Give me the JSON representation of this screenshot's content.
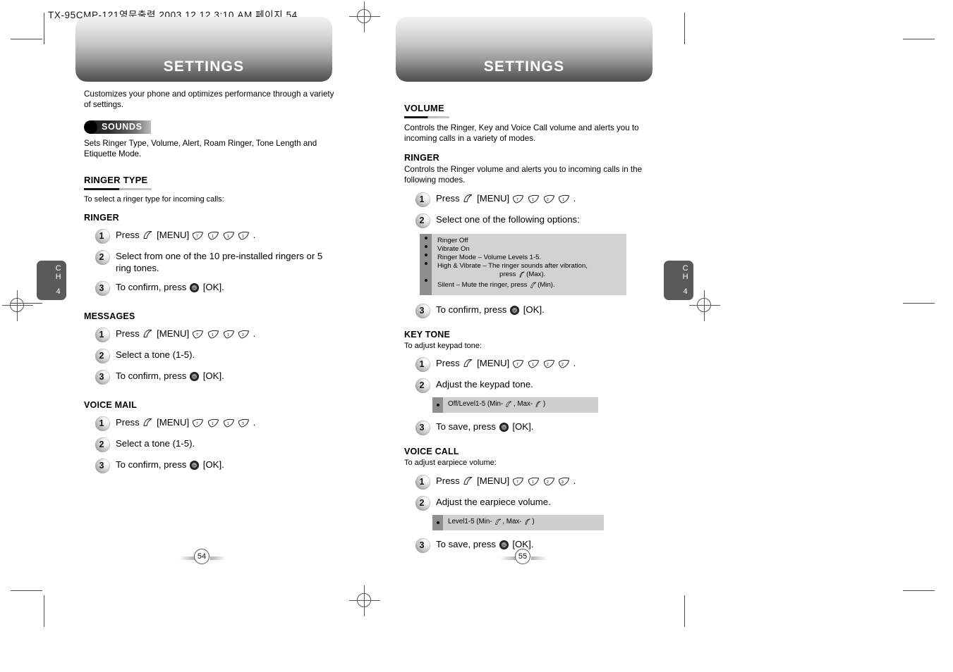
{
  "running_head": "TX-95CMP-121영문출력  2003.12.12 3:10 AM  페이지 54",
  "banner_title_left": "SETTINGS",
  "banner_title_right": "SETTINGS",
  "chapter_tab": {
    "label": "CH",
    "number": "4"
  },
  "folio": {
    "left": "54",
    "right": "55"
  },
  "left_page": {
    "intro": "Customizes your phone and optimizes performance through a variety of settings.",
    "badge": "SOUNDS",
    "badge_desc": "Sets Ringer Type, Volume, Alert, Roam Ringer, Tone Length and Etiquette Mode.",
    "section_title": "RINGER TYPE",
    "section_note": "To select a ringer type for incoming calls:",
    "groups": [
      {
        "heading": "RINGER",
        "steps": [
          {
            "num": "1",
            "text_before": "Press",
            "menu": "[MENU]",
            "keys": [
              "7",
              "1",
              "1",
              "1"
            ],
            "text_after": "."
          },
          {
            "num": "2",
            "text": "Select from one of the 10 pre-installed ringers or 5 ring tones."
          },
          {
            "num": "3",
            "text_before": "To confirm, press",
            "ok": "[OK]",
            "text_after": "."
          }
        ]
      },
      {
        "heading": "MESSAGES",
        "steps": [
          {
            "num": "1",
            "text_before": "Press",
            "menu": "[MENU]",
            "keys": [
              "7",
              "1",
              "1",
              "2"
            ],
            "text_after": "."
          },
          {
            "num": "2",
            "text": "Select a tone (1-5)."
          },
          {
            "num": "3",
            "text_before": "To confirm, press",
            "ok": "[OK]",
            "text_after": "."
          }
        ]
      },
      {
        "heading": "VOICE MAIL",
        "steps": [
          {
            "num": "1",
            "text_before": "Press",
            "menu": "[MENU]",
            "keys": [
              "7",
              "1",
              "1",
              "3"
            ],
            "text_after": "."
          },
          {
            "num": "2",
            "text": "Select a tone (1-5)."
          },
          {
            "num": "3",
            "text_before": "To confirm, press",
            "ok": "[OK]",
            "text_after": "."
          }
        ]
      }
    ]
  },
  "right_page": {
    "section_title": "VOLUME",
    "section_desc": "Controls the Ringer, Key and Voice Call volume and alerts you to incoming calls in a variety of modes.",
    "ringer": {
      "heading": "RINGER",
      "desc": "Controls the Ringer volume and alerts you to incoming calls in the following modes.",
      "steps": [
        {
          "num": "1",
          "text_before": "Press",
          "menu": "[MENU]",
          "keys": [
            "7",
            "1",
            "2",
            "1"
          ],
          "text_after": "."
        },
        {
          "num": "2",
          "text": "Select one of the following options:"
        },
        {
          "num": "3",
          "text_before": "To confirm, press",
          "ok": "[OK]",
          "text_after": "."
        }
      ],
      "options": [
        "Ringer Off",
        "Vibrate On",
        "Ringer Mode – Volume Levels 1-5.",
        "High & Vibrate – The ringer sounds  after vibration,",
        "Silent – Mute the ringer, press"
      ],
      "option_indent": "press",
      "option_indent_suffix": "(Max).",
      "option_last_suffix": "(Min)."
    },
    "key_tone": {
      "heading": "KEY TONE",
      "note": "To adjust keypad tone:",
      "steps": [
        {
          "num": "1",
          "text_before": "Press",
          "menu": "[MENU]",
          "keys": [
            "7",
            "1",
            "2",
            "2"
          ],
          "text_after": "."
        },
        {
          "num": "2",
          "text": "Adjust the keypad tone."
        },
        {
          "num": "3",
          "text_before": "To save, press",
          "ok": "[OK]",
          "text_after": "."
        }
      ],
      "option_prefix": "Off/Level1-5 (Min-",
      "option_mid": ", Max-",
      "option_suffix": ")"
    },
    "voice_call": {
      "heading": "VOICE CALL",
      "note": "To adjust earpiece volume:",
      "steps": [
        {
          "num": "1",
          "text_before": "Press",
          "menu": "[MENU]",
          "keys": [
            "7",
            "1",
            "2",
            "3"
          ],
          "text_after": "."
        },
        {
          "num": "2",
          "text": "Adjust the earpiece volume."
        },
        {
          "num": "3",
          "text_before": "To save, press",
          "ok": "[OK]",
          "text_after": "."
        }
      ],
      "option_prefix": "Level1-5 (Min-",
      "option_mid": ", Max-",
      "option_suffix": ")"
    }
  }
}
